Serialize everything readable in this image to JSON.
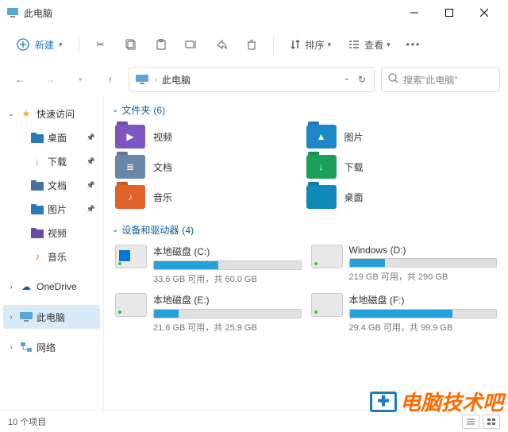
{
  "title": "此电脑",
  "toolbar": {
    "new": "新建",
    "sort": "排序",
    "view": "查看"
  },
  "address": {
    "text": "此电脑"
  },
  "search": {
    "placeholder": "搜索\"此电脑\""
  },
  "sidebar": {
    "quick": {
      "label": "快速访问",
      "items": [
        {
          "label": "桌面",
          "color": "#2a7ab9",
          "type": "desktop"
        },
        {
          "label": "下载",
          "color": "#2aa746",
          "type": "download"
        },
        {
          "label": "文档",
          "color": "#4a6fa1",
          "type": "doc"
        },
        {
          "label": "图片",
          "color": "#2a7ab9",
          "type": "picture"
        },
        {
          "label": "视频",
          "color": "#6a4ba0",
          "type": "video"
        },
        {
          "label": "音乐",
          "color": "#e06a2a",
          "type": "music"
        }
      ]
    },
    "onedrive": "OneDrive",
    "thispc": "此电脑",
    "network": "网络"
  },
  "groups": {
    "folders": {
      "label": "文件夹",
      "count": "(6)"
    },
    "drives": {
      "label": "设备和驱动器",
      "count": "(4)"
    }
  },
  "folders": [
    {
      "label": "视频",
      "bg": "#7d56c2",
      "glyph": "▶"
    },
    {
      "label": "图片",
      "bg": "#1e88c7",
      "glyph": "▲"
    },
    {
      "label": "文档",
      "bg": "#6b87a8",
      "glyph": "≣"
    },
    {
      "label": "下载",
      "bg": "#1aa05a",
      "glyph": "↓"
    },
    {
      "label": "音乐",
      "bg": "#e0622a",
      "glyph": "♪"
    },
    {
      "label": "桌面",
      "bg": "#0f8ab8",
      "glyph": ""
    }
  ],
  "drives": [
    {
      "name": "本地磁盘 (C:)",
      "free": "33.6 GB 可用，共 60.0 GB",
      "pct": 44,
      "win": true
    },
    {
      "name": "Windows (D:)",
      "free": "219 GB 可用，共 290 GB",
      "pct": 24,
      "win": false
    },
    {
      "name": "本地磁盘 (E:)",
      "free": "21.6 GB 可用，共 25.9 GB",
      "pct": 17,
      "win": false
    },
    {
      "name": "本地磁盘 (F:)",
      "free": "29.4 GB 可用，共 99.9 GB",
      "pct": 70,
      "win": false
    }
  ],
  "status": {
    "count": "10 个项目"
  },
  "watermark": "电脑技术吧"
}
